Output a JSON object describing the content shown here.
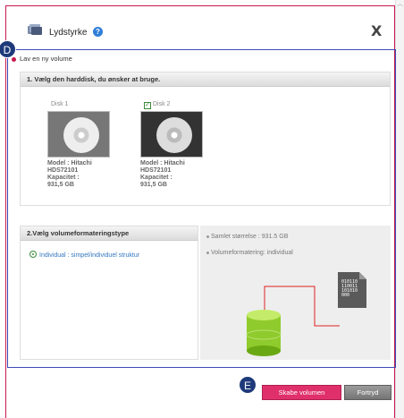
{
  "dialog": {
    "title": "Lydstyrke",
    "close_label": "X",
    "help_label": "?"
  },
  "badges": {
    "d": "D",
    "e": "E"
  },
  "new_volume_label": "Lav en ny volume",
  "step1": {
    "heading": "1. Vælg den harddisk, du ønsker at bruge.",
    "disks": [
      {
        "label": "Disk 1",
        "checked": false,
        "model": "Model : Hitachi",
        "model2": "HDS72101",
        "capacity": "Kapacitet :",
        "capacity2": "931,5 GB"
      },
      {
        "label": "Disk 2",
        "checked": true,
        "model": "Model : Hitachi",
        "model2": "HDS72101",
        "capacity": "Kapacitet :",
        "capacity2": "931,5 GB"
      }
    ]
  },
  "step2": {
    "heading": "2.Vælg volumeformateringstype",
    "option_label": "Individual : simpel/individuel struktur"
  },
  "summary": {
    "total_size": "Samlet størrelse : 931.5 GB",
    "format": "Volumeformatering: individual",
    "bits": [
      "010110",
      "110011",
      "101010",
      "000"
    ]
  },
  "buttons": {
    "create": "Skabe volumen",
    "cancel": "Fortryd"
  },
  "colors": {
    "accent": "#e0306b",
    "frame": "#c8194e",
    "main_frame": "#3d4bb5",
    "badge": "#1e3a7a"
  }
}
